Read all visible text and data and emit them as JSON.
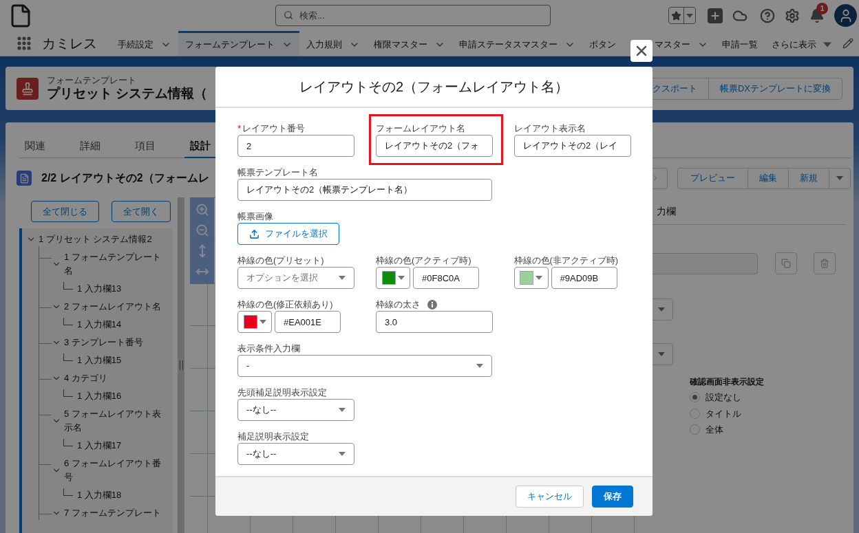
{
  "header": {
    "search": {
      "placeholder": "検索..."
    },
    "notification_count": "1"
  },
  "app_name": "カミレス",
  "nav": [
    {
      "label": "手続設定",
      "kind": "tab",
      "selected": false
    },
    {
      "label": "フォームテンプレート",
      "kind": "tab",
      "selected": true
    },
    {
      "label": "入力規則",
      "kind": "tab",
      "selected": false
    },
    {
      "label": "権限マスター",
      "kind": "tab",
      "selected": false
    },
    {
      "label": "申請ステータスマスター",
      "kind": "tab",
      "selected": false
    },
    {
      "label": "ボタン",
      "label_tail": "マスター",
      "kind": "tab",
      "selected": false
    },
    {
      "label": "申請一覧",
      "kind": "link",
      "selected": false
    },
    {
      "label": "さらに表示",
      "kind": "more",
      "selected": false
    }
  ],
  "record": {
    "object": "フォームテンプレート",
    "title": "プリセット システム情報（",
    "actions": [
      "クスポート",
      "帳票DXテンプレートに変換"
    ]
  },
  "tabs": [
    {
      "label": "関連",
      "selected": false
    },
    {
      "label": "詳細",
      "selected": false
    },
    {
      "label": "項目",
      "selected": false
    },
    {
      "label": "設計",
      "selected": true
    }
  ],
  "layout_title": "2/2 レイアウトその2（フォームレ",
  "layout_actions": [
    "プレビュー",
    "編集",
    "新規"
  ],
  "tree_buttons": [
    "全て閉じる",
    "全て開く"
  ],
  "tree": [
    {
      "label": "1 プリセット システム情報2",
      "expanded": true,
      "children": [
        {
          "label": "1 フォームテンプレート名",
          "expanded": true,
          "children": [
            {
              "label": "1 入力欄13"
            }
          ]
        },
        {
          "label": "2 フォームレイアウト名",
          "expanded": true,
          "children": [
            {
              "label": "1 入力欄14"
            }
          ]
        },
        {
          "label": "3 テンプレート番号",
          "expanded": true,
          "children": [
            {
              "label": "1 入力欄15"
            }
          ]
        },
        {
          "label": "4 カテゴリ",
          "expanded": true,
          "children": [
            {
              "label": "1 入力欄16"
            }
          ]
        },
        {
          "label": "5 フォームレイアウト表示名",
          "expanded": true,
          "children": [
            {
              "label": "1 入力欄17"
            }
          ]
        },
        {
          "label": "6 フォームレイアウト番号",
          "expanded": true,
          "children": [
            {
              "label": "1 入力欄18"
            }
          ]
        },
        {
          "label": "7 フォームテンプレート",
          "expanded": true
        }
      ]
    }
  ],
  "right_panel": {
    "tab": "力欄",
    "radio_group": {
      "title": "確認画面非表示設定",
      "options": [
        {
          "label": "設定なし",
          "selected": true
        },
        {
          "label": "タイトル",
          "selected": false
        },
        {
          "label": "全体",
          "selected": false
        }
      ]
    }
  },
  "modal": {
    "title": "レイアウトその2（フォームレイアウト名）",
    "rows": [
      [
        {
          "kind": "text",
          "label": "レイアウト番号",
          "required_mark": "*",
          "value": "2"
        },
        {
          "kind": "text",
          "label": "フォームレイアウト名",
          "highlighted": true,
          "value": "レイアウトその2（フォ"
        },
        {
          "kind": "text",
          "label": "レイアウト表示名",
          "value": "レイアウトその2（レイ"
        }
      ],
      [
        {
          "kind": "long_text",
          "label": "帳票テンプレート名",
          "value": "レイアウトその2（帳票テンプレート名）"
        }
      ],
      [
        {
          "kind": "file",
          "label": "帳票画像",
          "button": "ファイルを選択"
        }
      ],
      [
        {
          "kind": "select",
          "label": "枠線の色(プリセット)",
          "placeholder": "オプションを選択"
        },
        {
          "kind": "color",
          "label": "枠線の色(アクティブ時)",
          "color": "#0f8c0a",
          "value": "#0F8C0A"
        },
        {
          "kind": "color",
          "label": "枠線の色(非アクティブ時)",
          "color": "#9ad09b",
          "value": "#9AD09B"
        }
      ],
      [
        {
          "kind": "color",
          "label": "枠線の色(修正依頼あり)",
          "color": "#ea001e",
          "value": "#EA001E"
        },
        {
          "kind": "text",
          "label": "枠線の太さ",
          "info": true,
          "value": "3.0"
        }
      ],
      [
        {
          "kind": "long_select",
          "label": "表示条件入力欄",
          "value": "-"
        }
      ],
      [
        {
          "kind": "select",
          "label": "先頭補足説明表示設定",
          "value": "--なし--"
        }
      ],
      [
        {
          "kind": "select",
          "label": "補足説明表示設定",
          "value": "--なし--"
        }
      ]
    ],
    "buttons": [
      {
        "label": "キャンセル",
        "kind": "neutral"
      },
      {
        "label": "保存",
        "kind": "brand"
      }
    ]
  }
}
